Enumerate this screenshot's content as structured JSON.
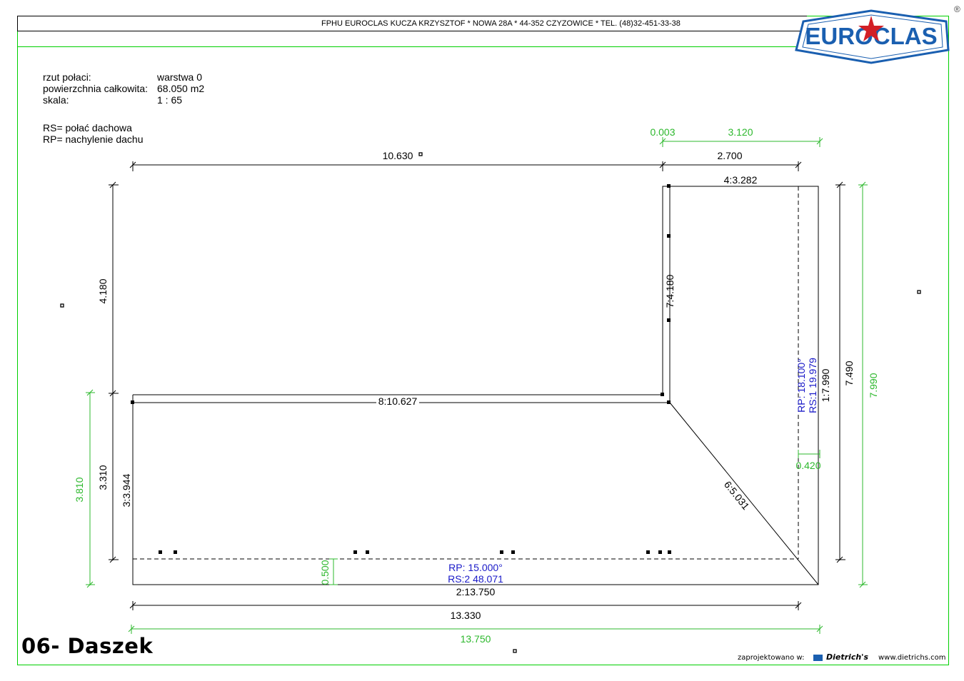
{
  "header": {
    "company_line": "FPHU EUROCLAS KUCZA KRZYSZTOF * NOWA 28A * 44-352 CZYZOWICE * TEL. (48)32-451-33-38",
    "logo_text": "EUROCLAS",
    "registered_mark": "®"
  },
  "info": {
    "projection_label": "rzut połaci:",
    "projection_value": "warstwa 0",
    "area_label": "powierzchnia całkowita:",
    "area_value": "68.050 m2",
    "scale_label": "skala:",
    "scale_value": "1 : 65",
    "legend_rs": "RS= połać dachowa",
    "legend_rp": "RP= nachylenie dachu"
  },
  "dimensions": {
    "top_left_span": "10.630",
    "top_right_span": "2.700",
    "green_top_small": "0.003",
    "green_top_right": "3.120",
    "edge_top_right": "4:3.282",
    "left_upper": "4.180",
    "left_lower": "3.310",
    "green_left": "3.810",
    "edge_inner_vertical": "7:4.180",
    "edge_horizontal_mid": "8:10.627",
    "edge_left": "3:3.944",
    "edge_diagonal": "6:5.031",
    "edge_right": "1:7.990",
    "right_total": "7.490",
    "green_right_total": "7.990",
    "green_offset_right": "0.420",
    "green_offset_bottom": "0.500",
    "edge_bottom": "2:13.750",
    "bottom_total": "13.330",
    "green_bottom_total": "13.750"
  },
  "slopes": {
    "rs2_rp": "RP:  15.000°",
    "rs2_label": "RS:2  48.071",
    "rs1_rp": "RP:  18.100°",
    "rs1_label": "RS:1  19.979"
  },
  "colors": {
    "green": "#2db82d",
    "blue": "#1a1ac8",
    "logo_blue": "#1a5fb0",
    "logo_red": "#d21f26"
  },
  "title": "06- Daszek",
  "footer": {
    "designed_with": "zaprojektowano w:",
    "brand": "Dietrich's",
    "website": "www.dietrichs.com"
  }
}
